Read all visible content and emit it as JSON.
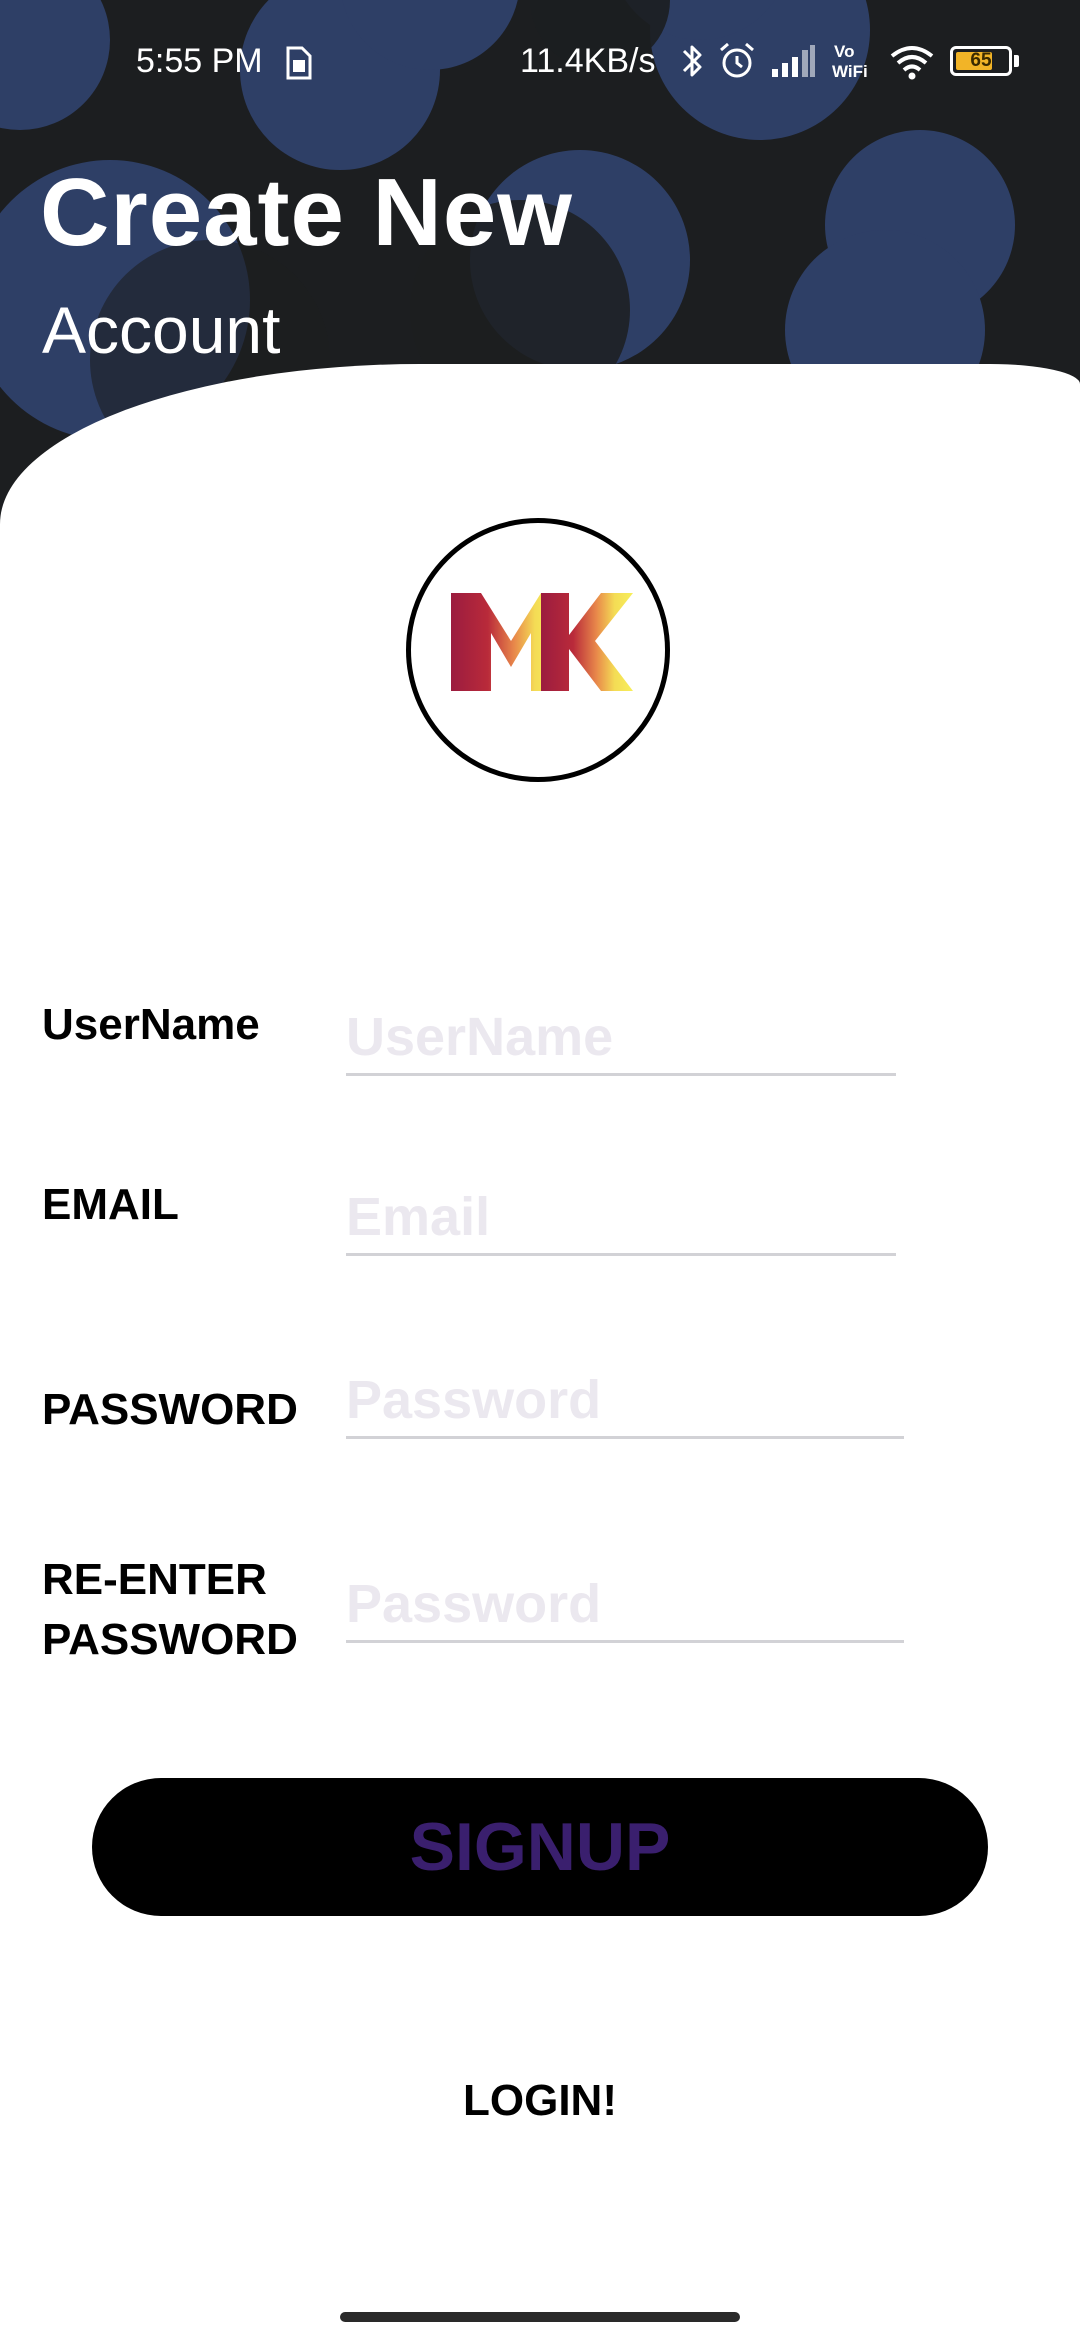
{
  "status_bar": {
    "time": "5:55 PM",
    "network_speed": "11.4KB/s",
    "battery_level": "65",
    "icons": [
      "sim-card-icon",
      "bluetooth-icon",
      "alarm-icon",
      "signal-icon",
      "vowifi-icon",
      "wifi-icon",
      "battery-icon"
    ],
    "vowifi_top": "Vo",
    "vowifi_bottom": "WiFi"
  },
  "header": {
    "title": "Create New",
    "subtitle": "Account"
  },
  "logo": {
    "text": "MK",
    "colors": [
      "#9b1c3f",
      "#f7ef5a"
    ]
  },
  "form": {
    "username": {
      "label": "UserName",
      "placeholder": "UserName",
      "value": ""
    },
    "email": {
      "label": "EMAIL",
      "placeholder": "Email",
      "value": ""
    },
    "password": {
      "label": "PASSWORD",
      "placeholder": "Password",
      "value": ""
    },
    "reenter_password": {
      "label_line1": "RE-ENTER",
      "label_line2": "PASSWORD",
      "placeholder": "Password",
      "value": ""
    }
  },
  "actions": {
    "signup_label": "SIGNUP",
    "login_label": "LOGIN!"
  },
  "colors": {
    "header_bg": "#1c1e20",
    "circle_accent": "#2e3f66",
    "button_bg": "#000000",
    "button_text": "#3a1f6e",
    "placeholder": "#ebe8ef"
  }
}
